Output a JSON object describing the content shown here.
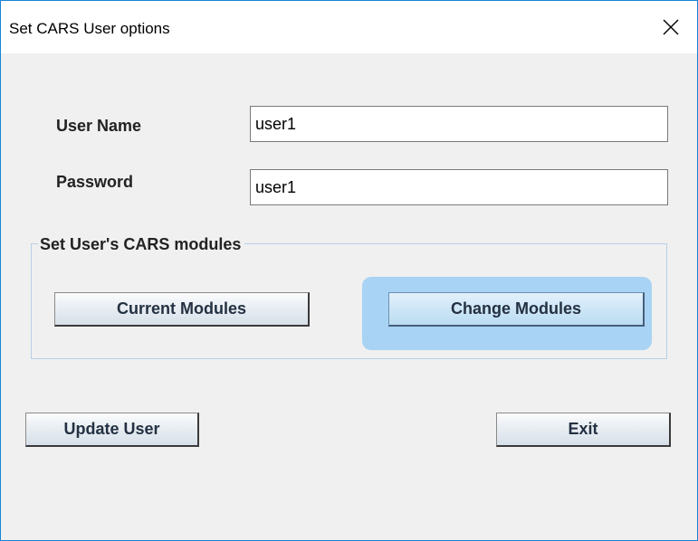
{
  "window": {
    "title": "Set CARS User options",
    "close_glyph": "close-icon",
    "accent_color": "#1883d7",
    "highlight_color": "#a8d3f4"
  },
  "form": {
    "username_label": "User Name",
    "username_value": "user1",
    "password_label": "Password",
    "password_value": "user1"
  },
  "modules_group": {
    "legend": "Set User's CARS  modules",
    "current_button": "Current Modules",
    "change_button": "Change Modules"
  },
  "actions": {
    "update_button": "Update User",
    "exit_button": "Exit"
  }
}
